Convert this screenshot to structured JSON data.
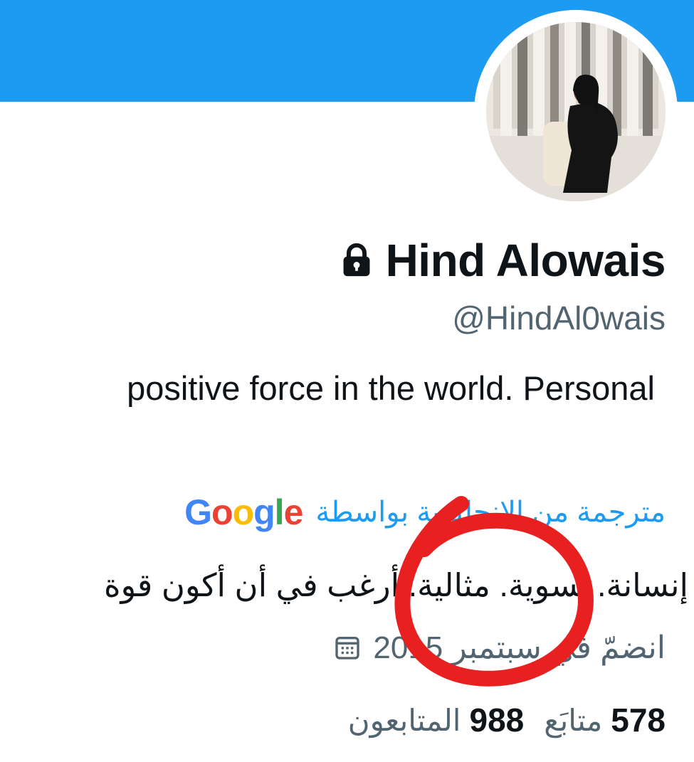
{
  "profile": {
    "display_name": "Hind Alowais",
    "handle": "@HindAl0wais",
    "protected_icon": "lock-icon",
    "avatar": "profile-photo",
    "bio": "positive force in the world. Personal"
  },
  "translation": {
    "label": "مترجمة من الإنجليزية بواسطة",
    "provider": "Google",
    "translated_bio": "إنسانة. نسوية. مثالية. أرغب في أن أكون قوة"
  },
  "joined": {
    "icon": "calendar-icon",
    "text": "انضمّ في سبتمبر 2015"
  },
  "stats": {
    "following_count": "578",
    "following_label": "متابَع",
    "followers_count": "988",
    "followers_label": "المتابعون"
  },
  "colors": {
    "banner": "#1d9bf0",
    "link": "#1d9bf0",
    "secondary_text": "#536471",
    "annotation": "#e8201f"
  }
}
